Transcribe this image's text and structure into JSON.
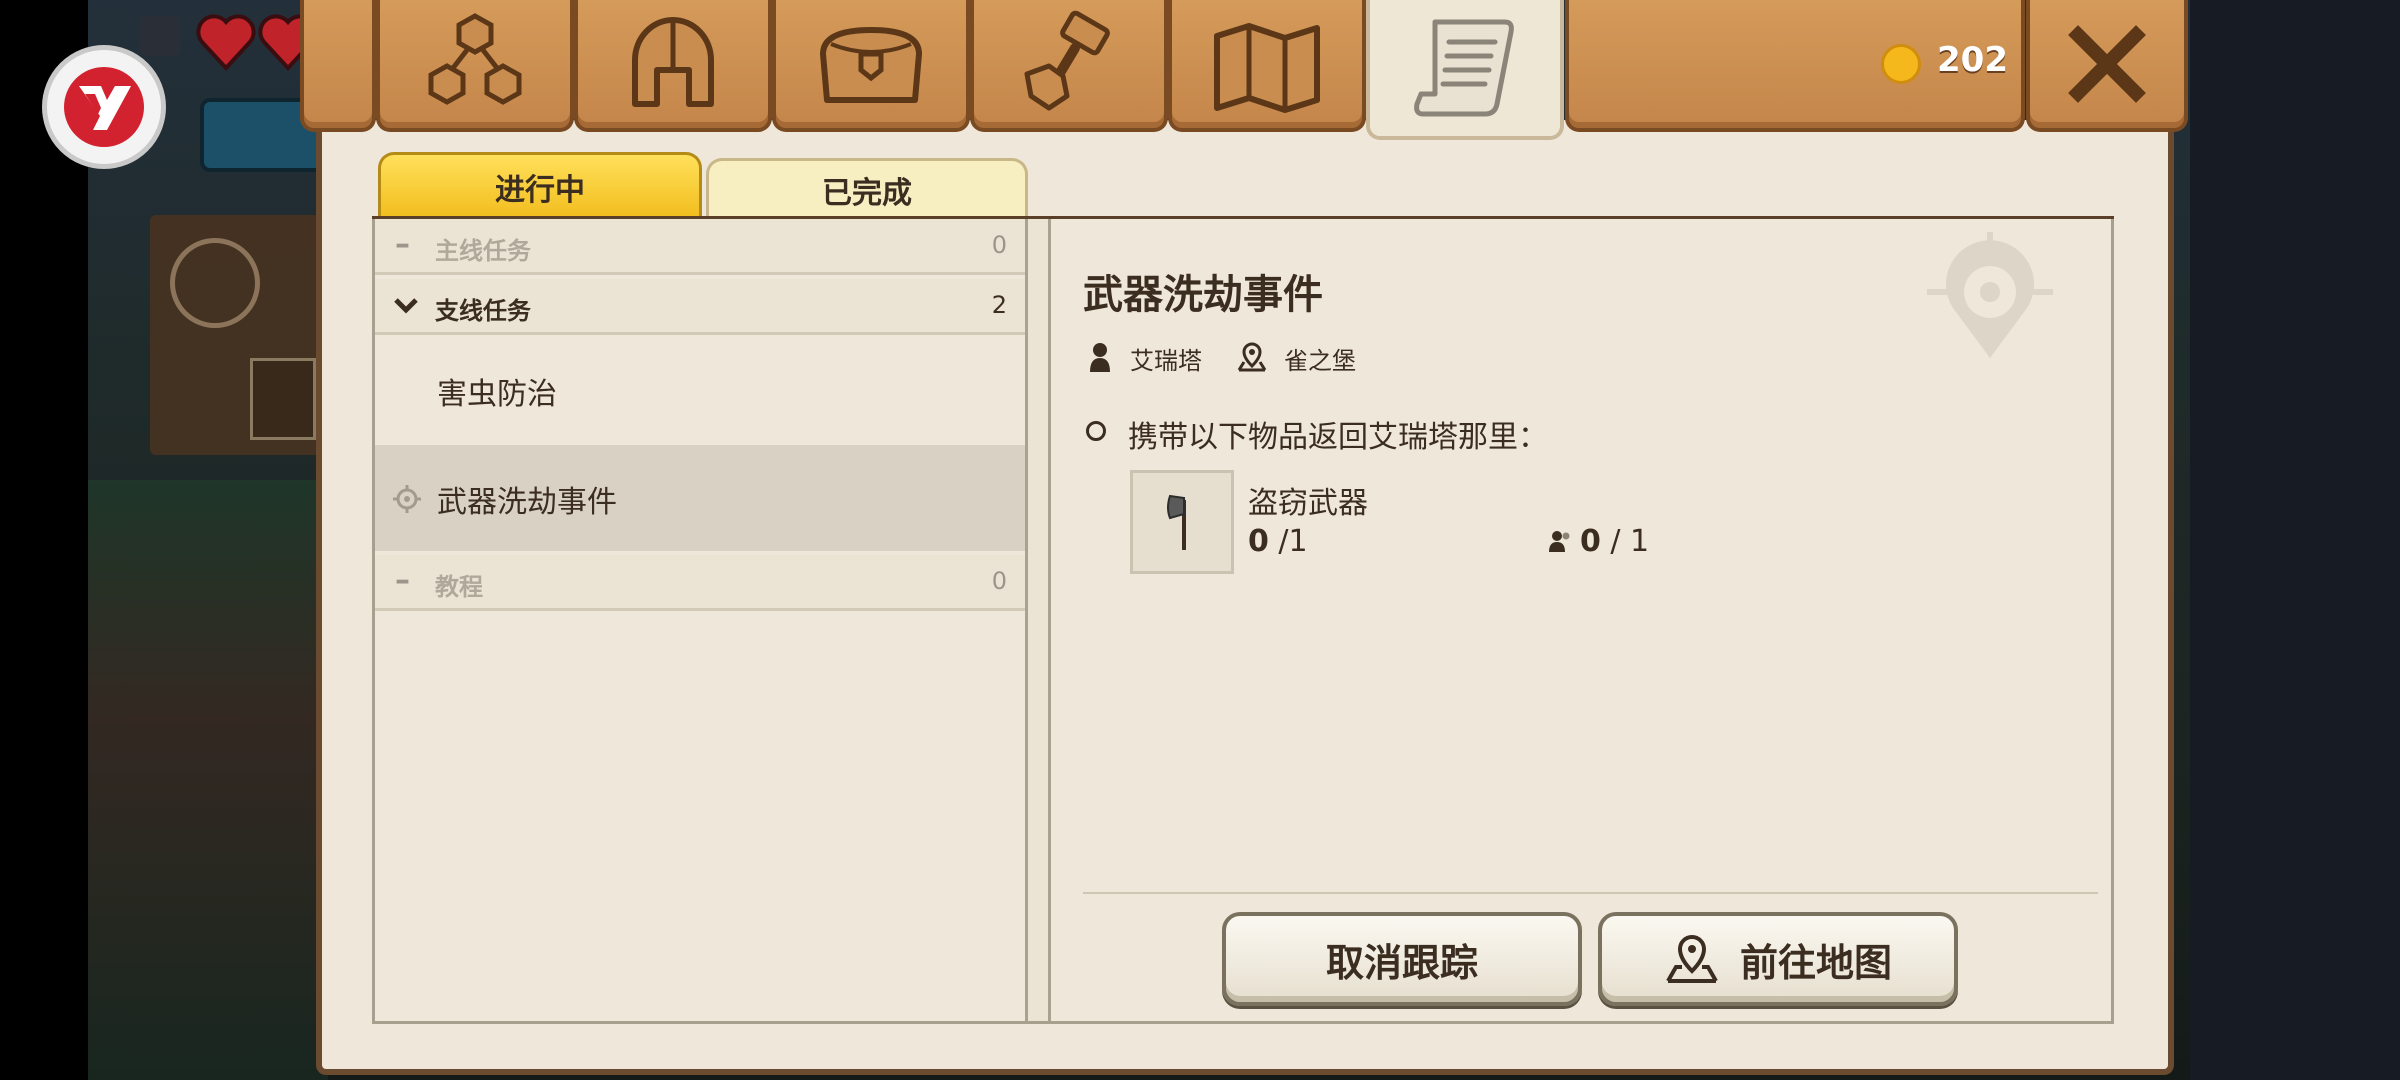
{
  "top_bar": {
    "tabs": [
      {
        "name": "skills-tab",
        "icon": "hexagon-tree-icon"
      },
      {
        "name": "equipment-tab",
        "icon": "helmet-icon"
      },
      {
        "name": "inventory-tab",
        "icon": "chest-icon"
      },
      {
        "name": "crafting-tab",
        "icon": "hammer-icon"
      },
      {
        "name": "map-tab",
        "icon": "map-icon"
      },
      {
        "name": "quests-tab",
        "icon": "scroll-icon",
        "active": true
      }
    ],
    "coins": "202",
    "close_icon": "close-icon"
  },
  "quest_tabs": {
    "in_progress": "进行中",
    "completed": "已完成"
  },
  "quest_list": {
    "main_category": {
      "label": "主线任务",
      "count": "0"
    },
    "side_category": {
      "label": "支线任务",
      "count": "2"
    },
    "side_quests": [
      "害虫防治",
      "武器洗劫事件"
    ],
    "tutorial_category": {
      "label": "教程",
      "count": "0"
    }
  },
  "detail": {
    "title": "武器洗劫事件",
    "npc": "艾瑞塔",
    "location": "雀之堡",
    "objective": "携带以下物品返回艾瑞塔那里：",
    "item_name": "盗窃武器",
    "item_have": "0",
    "item_need": " /1",
    "party_have": "0",
    "party_need": " / 1"
  },
  "buttons": {
    "cancel_tracking": "取消跟踪",
    "go_to_map": "前往地图"
  },
  "colors": {
    "wood": "#c98d50",
    "parchment": "#efe8da",
    "tab_active": "#f2bd1e",
    "text": "#3b2d20"
  }
}
